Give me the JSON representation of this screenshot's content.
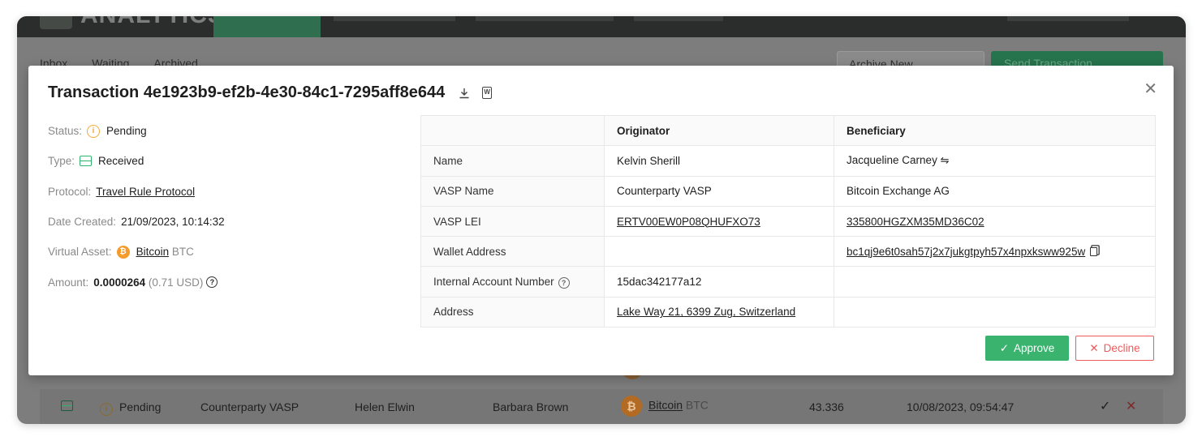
{
  "background": {
    "app_name": "ANALYTICS",
    "user_label": "",
    "tabs": [
      "Inbox",
      "Waiting",
      "Archived"
    ],
    "archive_button": "Archive New Transaction",
    "send_button": "Send Transaction Notification",
    "row": {
      "status": "Pending",
      "counterparty": "Counterparty VASP",
      "originator": "Helen Elwin",
      "beneficiary": "Barbara Brown",
      "asset_name": "Bitcoin",
      "asset_symbol": "BTC",
      "amount": "43.336",
      "date": "10/08/2023, 09:54:47"
    }
  },
  "modal": {
    "title": "Transaction 4e1923b9-ef2b-4e30-84c1-7295aff8e644",
    "meta": {
      "status_label": "Status",
      "status_value": "Pending",
      "type_label": "Type",
      "type_value": "Received",
      "protocol_label": "Protocol",
      "protocol_value": "Travel Rule Protocol",
      "date_label": "Date Created",
      "date_value": "21/09/2023, 10:14:32",
      "asset_label": "Virtual Asset",
      "asset_name": "Bitcoin",
      "asset_symbol": "BTC",
      "amount_label": "Amount",
      "amount_value": "0.0000264",
      "amount_fiat": "(0.71 USD)"
    },
    "table": {
      "headers": [
        "",
        "Originator",
        "Beneficiary"
      ],
      "rows": [
        {
          "label": "Name",
          "originator": "Kelvin Sherill",
          "beneficiary": "Jacqueline Carney"
        },
        {
          "label": "VASP Name",
          "originator": "Counterparty VASP",
          "beneficiary": "Bitcoin Exchange AG"
        },
        {
          "label": "VASP LEI",
          "originator": "ERTV00EW0P08QHUFXO73",
          "beneficiary": "335800HGZXM35MD36C02"
        },
        {
          "label": "Wallet Address",
          "originator": "",
          "beneficiary": "bc1qj9e6t0sah57j2x7jukgtpyh57x4npxksww925w"
        },
        {
          "label": "Internal Account Number",
          "originator": "15dac342177a12",
          "beneficiary": ""
        },
        {
          "label": "Address",
          "originator": "Lake Way 21, 6399 Zug, Switzerland",
          "beneficiary": ""
        }
      ]
    },
    "approve_label": "Approve",
    "decline_label": "Decline"
  },
  "colors": {
    "pending": "#f2a93b",
    "received": "#2fb36d",
    "approve": "#39b36d",
    "decline": "#ef5b5b",
    "bitcoin": "#f59b2b"
  },
  "icons": {
    "status": "pending-info-icon",
    "type": "inbox-icon",
    "asset": "bitcoin-icon",
    "download": "download-icon",
    "doc": "word-doc-icon",
    "swap": "swap-arrows-icon",
    "copy": "copy-icon",
    "help": "question-circle-icon",
    "close": "close-icon"
  }
}
